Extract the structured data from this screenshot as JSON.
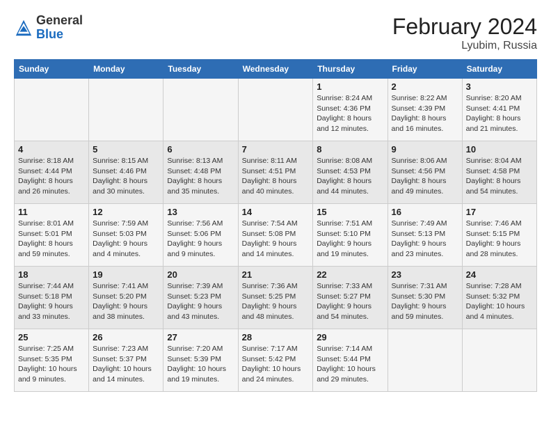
{
  "header": {
    "logo_general": "General",
    "logo_blue": "Blue",
    "month_year": "February 2024",
    "location": "Lyubim, Russia"
  },
  "days_of_week": [
    "Sunday",
    "Monday",
    "Tuesday",
    "Wednesday",
    "Thursday",
    "Friday",
    "Saturday"
  ],
  "weeks": [
    [
      {
        "day": "",
        "info": ""
      },
      {
        "day": "",
        "info": ""
      },
      {
        "day": "",
        "info": ""
      },
      {
        "day": "",
        "info": ""
      },
      {
        "day": "1",
        "info": "Sunrise: 8:24 AM\nSunset: 4:36 PM\nDaylight: 8 hours and 12 minutes."
      },
      {
        "day": "2",
        "info": "Sunrise: 8:22 AM\nSunset: 4:39 PM\nDaylight: 8 hours and 16 minutes."
      },
      {
        "day": "3",
        "info": "Sunrise: 8:20 AM\nSunset: 4:41 PM\nDaylight: 8 hours and 21 minutes."
      }
    ],
    [
      {
        "day": "4",
        "info": "Sunrise: 8:18 AM\nSunset: 4:44 PM\nDaylight: 8 hours and 26 minutes."
      },
      {
        "day": "5",
        "info": "Sunrise: 8:15 AM\nSunset: 4:46 PM\nDaylight: 8 hours and 30 minutes."
      },
      {
        "day": "6",
        "info": "Sunrise: 8:13 AM\nSunset: 4:48 PM\nDaylight: 8 hours and 35 minutes."
      },
      {
        "day": "7",
        "info": "Sunrise: 8:11 AM\nSunset: 4:51 PM\nDaylight: 8 hours and 40 minutes."
      },
      {
        "day": "8",
        "info": "Sunrise: 8:08 AM\nSunset: 4:53 PM\nDaylight: 8 hours and 44 minutes."
      },
      {
        "day": "9",
        "info": "Sunrise: 8:06 AM\nSunset: 4:56 PM\nDaylight: 8 hours and 49 minutes."
      },
      {
        "day": "10",
        "info": "Sunrise: 8:04 AM\nSunset: 4:58 PM\nDaylight: 8 hours and 54 minutes."
      }
    ],
    [
      {
        "day": "11",
        "info": "Sunrise: 8:01 AM\nSunset: 5:01 PM\nDaylight: 8 hours and 59 minutes."
      },
      {
        "day": "12",
        "info": "Sunrise: 7:59 AM\nSunset: 5:03 PM\nDaylight: 9 hours and 4 minutes."
      },
      {
        "day": "13",
        "info": "Sunrise: 7:56 AM\nSunset: 5:06 PM\nDaylight: 9 hours and 9 minutes."
      },
      {
        "day": "14",
        "info": "Sunrise: 7:54 AM\nSunset: 5:08 PM\nDaylight: 9 hours and 14 minutes."
      },
      {
        "day": "15",
        "info": "Sunrise: 7:51 AM\nSunset: 5:10 PM\nDaylight: 9 hours and 19 minutes."
      },
      {
        "day": "16",
        "info": "Sunrise: 7:49 AM\nSunset: 5:13 PM\nDaylight: 9 hours and 23 minutes."
      },
      {
        "day": "17",
        "info": "Sunrise: 7:46 AM\nSunset: 5:15 PM\nDaylight: 9 hours and 28 minutes."
      }
    ],
    [
      {
        "day": "18",
        "info": "Sunrise: 7:44 AM\nSunset: 5:18 PM\nDaylight: 9 hours and 33 minutes."
      },
      {
        "day": "19",
        "info": "Sunrise: 7:41 AM\nSunset: 5:20 PM\nDaylight: 9 hours and 38 minutes."
      },
      {
        "day": "20",
        "info": "Sunrise: 7:39 AM\nSunset: 5:23 PM\nDaylight: 9 hours and 43 minutes."
      },
      {
        "day": "21",
        "info": "Sunrise: 7:36 AM\nSunset: 5:25 PM\nDaylight: 9 hours and 48 minutes."
      },
      {
        "day": "22",
        "info": "Sunrise: 7:33 AM\nSunset: 5:27 PM\nDaylight: 9 hours and 54 minutes."
      },
      {
        "day": "23",
        "info": "Sunrise: 7:31 AM\nSunset: 5:30 PM\nDaylight: 9 hours and 59 minutes."
      },
      {
        "day": "24",
        "info": "Sunrise: 7:28 AM\nSunset: 5:32 PM\nDaylight: 10 hours and 4 minutes."
      }
    ],
    [
      {
        "day": "25",
        "info": "Sunrise: 7:25 AM\nSunset: 5:35 PM\nDaylight: 10 hours and 9 minutes."
      },
      {
        "day": "26",
        "info": "Sunrise: 7:23 AM\nSunset: 5:37 PM\nDaylight: 10 hours and 14 minutes."
      },
      {
        "day": "27",
        "info": "Sunrise: 7:20 AM\nSunset: 5:39 PM\nDaylight: 10 hours and 19 minutes."
      },
      {
        "day": "28",
        "info": "Sunrise: 7:17 AM\nSunset: 5:42 PM\nDaylight: 10 hours and 24 minutes."
      },
      {
        "day": "29",
        "info": "Sunrise: 7:14 AM\nSunset: 5:44 PM\nDaylight: 10 hours and 29 minutes."
      },
      {
        "day": "",
        "info": ""
      },
      {
        "day": "",
        "info": ""
      }
    ]
  ]
}
